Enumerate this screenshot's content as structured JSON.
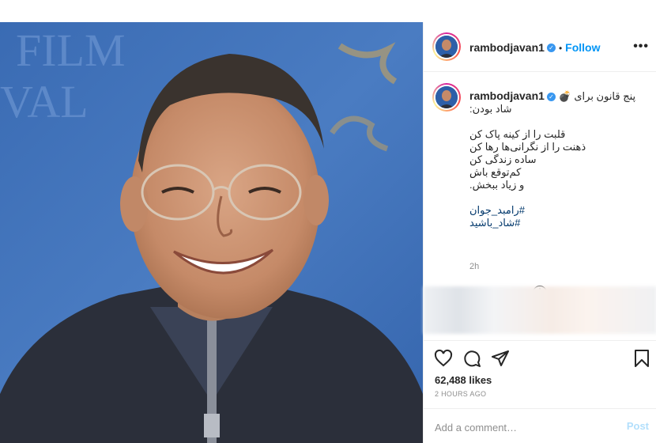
{
  "post": {
    "username": "rambodjavan1",
    "follow_label": "Follow",
    "dot": "•",
    "more_label": "•••"
  },
  "caption": {
    "username": "rambodjavan1",
    "line1": "پنج قانون برای 💣",
    "line2": "شاد بودن:",
    "rule1": "قلبت را از کینه پاک کن",
    "rule2": "ذهنت را از نگرانی‌ها رها کن",
    "rule3": "ساده زندگی کن",
    "rule4": "کم‌توقع باش",
    "rule5": "و زیاد ببخش.",
    "hashtag1": "#رامبد_جوان",
    "hashtag2": "#شاد_باشید",
    "time": "2h"
  },
  "stats": {
    "likes": "62,488 likes",
    "time_ago": "2 HOURS AGO"
  },
  "comment": {
    "placeholder": "Add a comment…",
    "post_label": "Post"
  },
  "photo": {
    "backdrop_text_1": "FILM",
    "backdrop_text_2": "VAL"
  },
  "icons": {
    "verified": "verified-badge-icon",
    "heart": "heart-icon",
    "comment": "comment-icon",
    "share": "share-icon",
    "bookmark": "bookmark-icon",
    "add": "add-circle-icon",
    "more": "more-options-icon"
  },
  "colors": {
    "accent": "#0095f6",
    "text": "#262626",
    "muted": "#8e8e8e",
    "backdrop": "#3f6fb6"
  }
}
